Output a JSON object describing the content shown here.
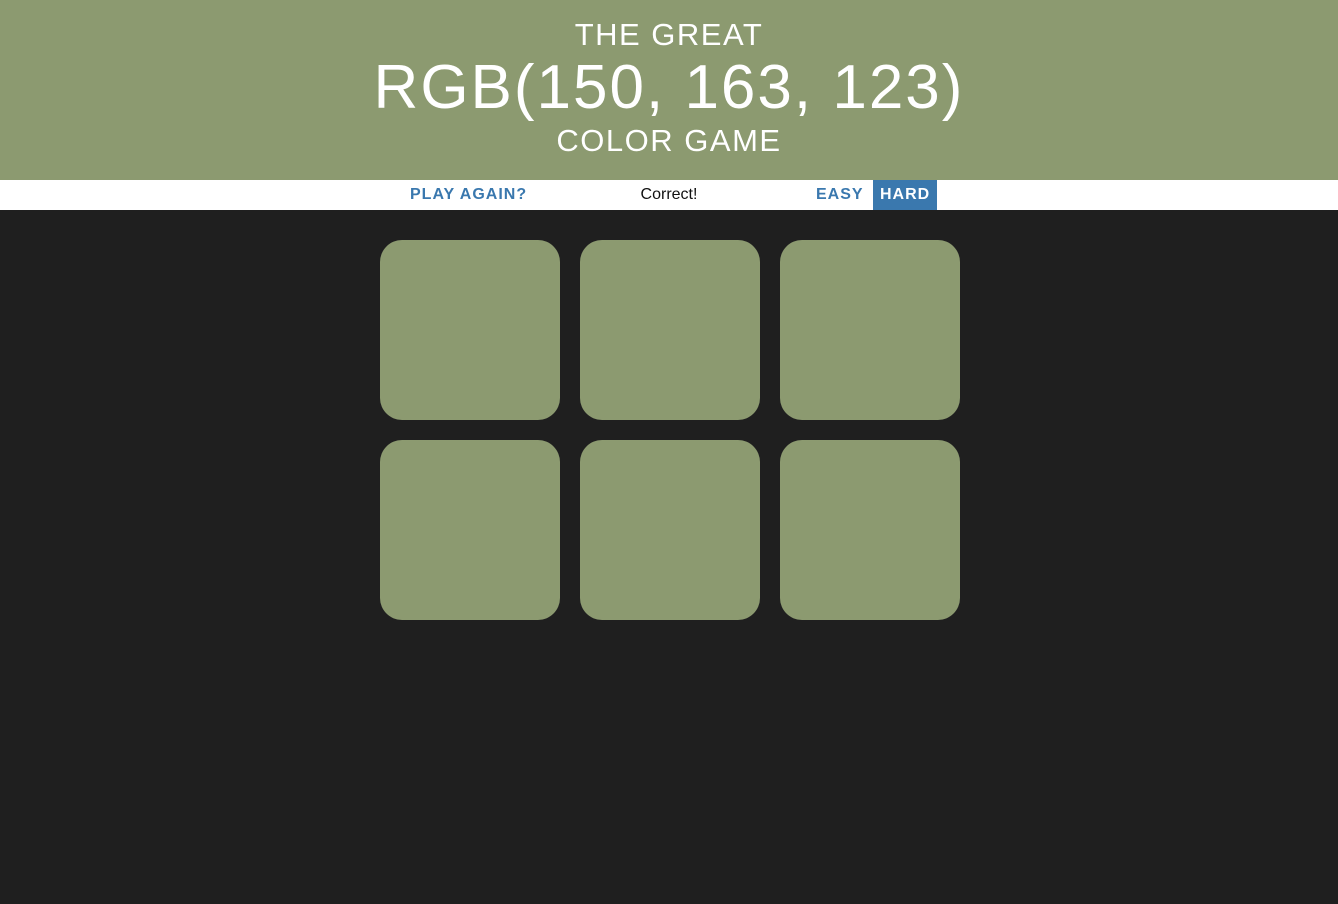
{
  "header": {
    "line_top": "THE GREAT",
    "rgb_display": "RGB(150, 163, 123)",
    "line_bottom": "COLOR GAME",
    "background_color": "#8c9a70"
  },
  "stripe": {
    "reset_label": "PLAY AGAIN?",
    "message": "Correct!",
    "easy_label": "EASY",
    "hard_label": "HARD",
    "selected_mode": "HARD",
    "accent_color": "#3a78ae"
  },
  "squares": {
    "count": 6,
    "color": "#8c9a70",
    "page_background": "#1f1f1f"
  }
}
